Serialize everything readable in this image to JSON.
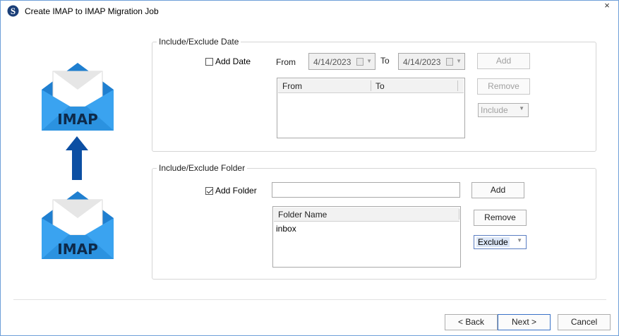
{
  "window": {
    "title": "Create IMAP to IMAP Migration Job",
    "close_glyph": "×",
    "app_icon": "s-logo-icon"
  },
  "illustration": {
    "top_envelope_label": "IMAP",
    "bottom_envelope_label": "IMAP",
    "envelope_color": "#2a8ad6",
    "arrow_color": "#0c4fa3"
  },
  "date_group": {
    "title": "Include/Exclude Date",
    "checkbox_label": "Add Date",
    "checked": false,
    "from_label": "From",
    "from_value": "4/14/2023",
    "to_label": "To",
    "to_value": "4/14/2023",
    "add_button": "Add",
    "remove_button": "Remove",
    "mode_select": "Include",
    "table_headers": [
      "From",
      "To"
    ],
    "rows": []
  },
  "folder_group": {
    "title": "Include/Exclude Folder",
    "checkbox_label": "Add Folder",
    "checked": true,
    "folder_input_value": "",
    "add_button": "Add",
    "remove_button": "Remove",
    "mode_select": "Exclude",
    "table_headers": [
      "Folder Name"
    ],
    "rows": [
      "inbox"
    ]
  },
  "footer": {
    "back_button": "< Back",
    "next_button": "Next >",
    "cancel_button": "Cancel"
  }
}
